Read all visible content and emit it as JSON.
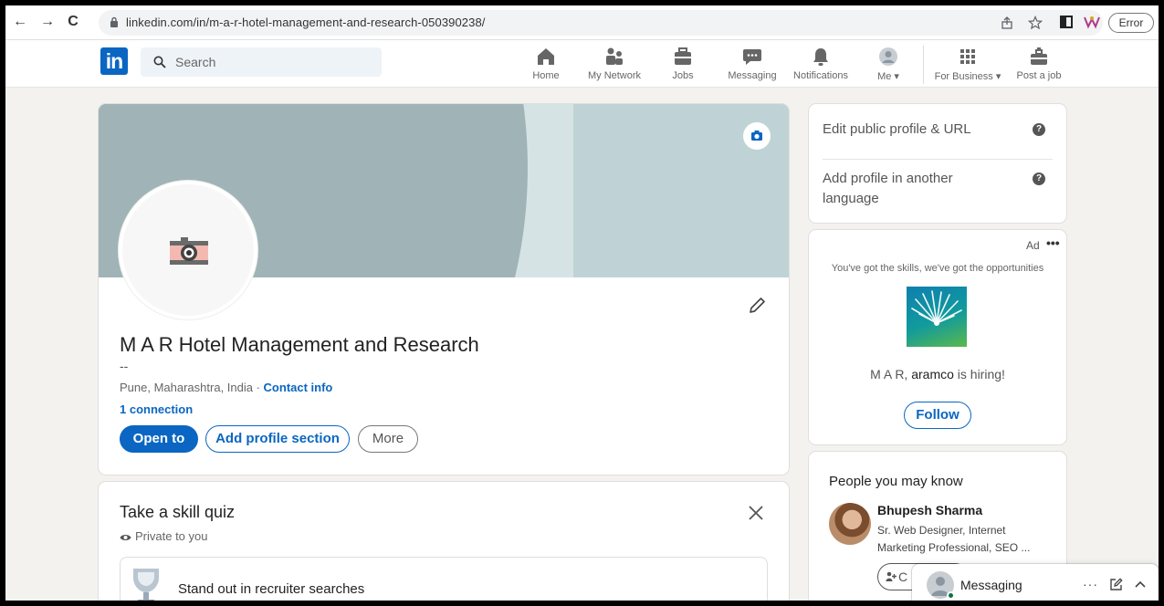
{
  "browser": {
    "url": "linkedin.com/in/m-a-r-hotel-management-and-research-050390238/",
    "error_label": "Error",
    "back_glyph": "←",
    "forward_glyph": "→",
    "reload_glyph": "C"
  },
  "header": {
    "logo_text": "in",
    "search_placeholder": "Search",
    "nav": [
      {
        "label": "Home",
        "icon": "home-icon"
      },
      {
        "label": "My Network",
        "icon": "network-icon"
      },
      {
        "label": "Jobs",
        "icon": "briefcase-icon"
      },
      {
        "label": "Messaging",
        "icon": "chat-icon"
      },
      {
        "label": "Notifications",
        "icon": "bell-icon"
      },
      {
        "label": "Me",
        "icon": "avatar-icon"
      },
      {
        "label": "For Business",
        "icon": "grid-icon"
      },
      {
        "label": "Post a job",
        "icon": "post-job-icon"
      }
    ]
  },
  "profile": {
    "name": "M A R Hotel Management and Research",
    "headline": "--",
    "location": "Pune, Maharashtra, India ·",
    "contact_info": "Contact info",
    "connections": "1 connection",
    "open_to": "Open to",
    "add_section": "Add profile section",
    "more": "More"
  },
  "quiz": {
    "title": "Take a skill quiz",
    "privacy": "Private to you",
    "item": "Stand out in recruiter searches"
  },
  "right_rail": {
    "edit_public": "Edit public profile & URL",
    "add_language": "Add profile in another language",
    "ad": {
      "label": "Ad",
      "dots": "•••",
      "tagline": "You've got the skills, we've got the opportunities",
      "hiring_prefix": "M A R, ",
      "hiring_company": "aramco",
      "hiring_suffix": " is hiring!",
      "follow": "Follow"
    },
    "pymk": {
      "title": "People you may know",
      "person_name": "Bhupesh Sharma",
      "person_headline": "Sr. Web Designer, Internet Marketing Professional, SEO ...",
      "connect_label": "C"
    }
  },
  "messaging": {
    "label": "Messaging",
    "more": "···"
  },
  "colors": {
    "brand": "#0a66c2",
    "banner_dark": "#a0b4b7",
    "banner_light": "#bfd3d6",
    "online": "#057642"
  }
}
